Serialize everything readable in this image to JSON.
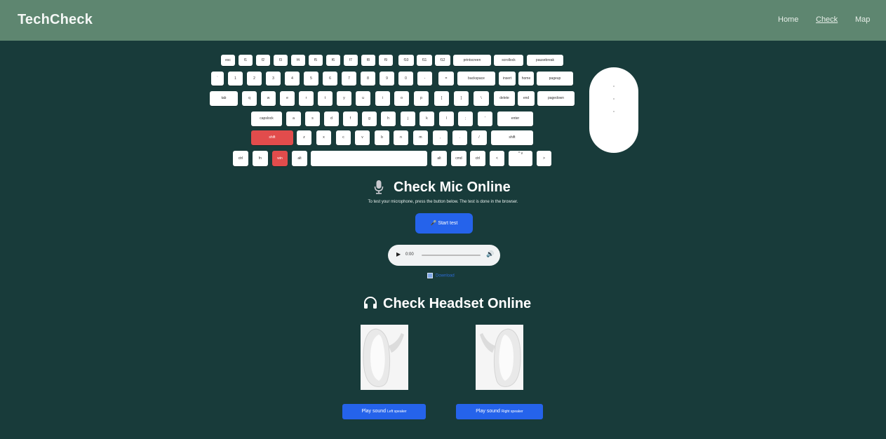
{
  "header": {
    "brand": "TechCheck",
    "nav": [
      {
        "label": "Home"
      },
      {
        "label": "Check"
      },
      {
        "label": "Map"
      }
    ]
  },
  "keyboard": {
    "rows": [
      [
        "esc",
        "f1",
        "f2",
        "f3",
        "f4",
        "f5",
        "f6",
        "f7",
        "f8",
        "f9",
        "f10",
        "f11",
        "f12",
        "printscreen",
        "scrollock",
        "pausebreak"
      ],
      [
        "`",
        "1",
        "2",
        "3",
        "4",
        "5",
        "6",
        "7",
        "8",
        "9",
        "0",
        "-",
        "=",
        "backspace",
        "insert",
        "home",
        "pageup"
      ],
      [
        "tab",
        "q",
        "w",
        "e",
        "r",
        "t",
        "y",
        "u",
        "i",
        "o",
        "p",
        "[",
        "]",
        "\\",
        "delete",
        "end",
        "pagedown"
      ],
      [
        "capslock",
        "a",
        "s",
        "d",
        "f",
        "g",
        "h",
        "j",
        "k",
        "l",
        ";",
        "'",
        "enter"
      ],
      [
        "shift",
        "z",
        "x",
        "c",
        "v",
        "b",
        "n",
        "m",
        ",",
        ".",
        "/",
        "shift"
      ],
      [
        "ctrl",
        "fn",
        "win",
        "alt",
        "",
        "alt",
        "cmd",
        "ctrl",
        "<",
        "^ v",
        ">"
      ]
    ],
    "pressed_color": "#e24c4c"
  },
  "mic": {
    "title": "Check Mic Online",
    "subtitle": "To test your microphone, press the button below. The test is done in the browser.",
    "start_button": "🎤 Start test",
    "audio_time": "0:00",
    "download_label": "Download"
  },
  "headset": {
    "title": "Check Headset Online",
    "left_button_main": "Play sound",
    "left_button_sub": "Left speaker",
    "right_button_main": "Play sound",
    "right_button_sub": "Right speaker"
  },
  "colors": {
    "background": "#183b3a",
    "header": "#5e8670",
    "accent": "#2563eb"
  }
}
